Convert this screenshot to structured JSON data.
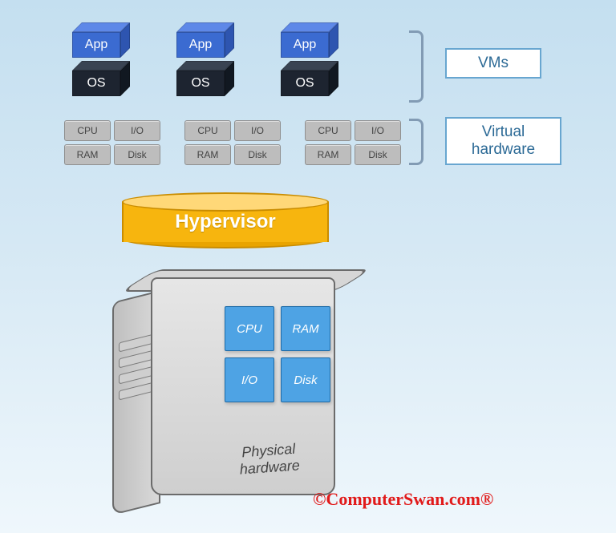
{
  "vm_stacks": [
    {
      "app": "App",
      "os": "OS"
    },
    {
      "app": "App",
      "os": "OS"
    },
    {
      "app": "App",
      "os": "OS"
    }
  ],
  "virtual_hw": [
    {
      "cpu": "CPU",
      "io": "I/O",
      "ram": "RAM",
      "disk": "Disk"
    },
    {
      "cpu": "CPU",
      "io": "I/O",
      "ram": "RAM",
      "disk": "Disk"
    },
    {
      "cpu": "CPU",
      "io": "I/O",
      "ram": "RAM",
      "disk": "Disk"
    }
  ],
  "legend": {
    "vms": "VMs",
    "vhw_line1": "Virtual",
    "vhw_line2": "hardware"
  },
  "hypervisor": "Hypervisor",
  "physical": {
    "cpu": "CPU",
    "ram": "RAM",
    "io": "I/O",
    "disk": "Disk",
    "label_line1": "Physical",
    "label_line2": "hardware"
  },
  "credit": "©ComputerSwan.com®"
}
